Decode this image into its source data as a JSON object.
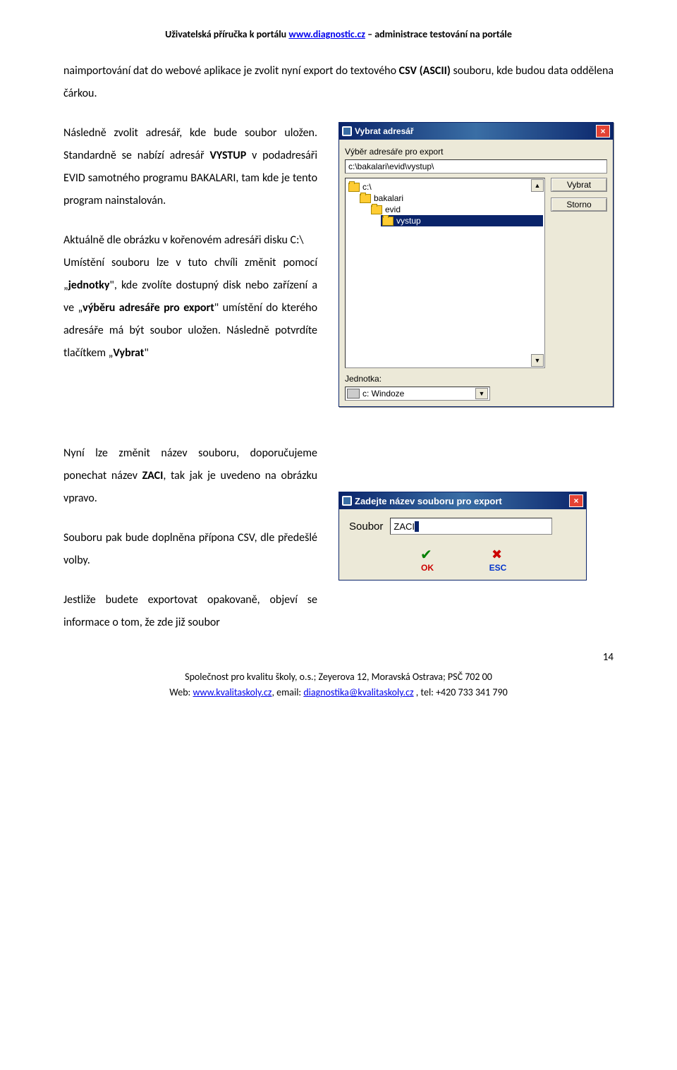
{
  "header": {
    "prefix": "Uživatelská příručka k portálu ",
    "link": "www.diagnostic.cz",
    "suffix": " – administrace testování na portále"
  },
  "p1": {
    "t1": "naimportování dat do webové aplikace je zvolit nyní export do textového ",
    "bold1": "CSV (ASCII)",
    "t2": " souboru, kde budou data oddělena čárkou."
  },
  "p2": {
    "t1": "Následně zvolit adresář, kde bude soubor uložen. Standardně se nabízí adresář ",
    "bold1": "VYSTUP",
    "t2": " v podadresáři EVID samotného programu BAKALARI, tam kde je tento program nainstalován."
  },
  "p3": {
    "t1": "Aktuálně dle obrázku v kořenovém adresáři disku C:\\",
    "t2": "Umístění souboru lze v tuto chvíli změnit pomocí „",
    "bold1": "jednotky",
    "t3": "\", kde zvolíte dostupný disk nebo zařízení a ve „",
    "bold2": "výběru adresáře pro export",
    "t4": "\" umístění do kterého adresáře má být soubor uložen. Následně potvrdíte tlačítkem „",
    "bold3": "Vybrat",
    "t5": "\""
  },
  "p4": {
    "t1": "Nyní lze změnit název souboru, doporučujeme ponechat název ",
    "bold1": "ZACI",
    "t2": ", tak jak je uvedeno na obrázku vpravo."
  },
  "p5": "Souboru pak bude doplněna přípona CSV, dle předešlé volby.",
  "p6": "Jestliže budete exportovat opakovaně, objeví se informace o tom, že zde již soubor",
  "dialog1": {
    "title": "Vybrat adresář",
    "label_top": "Výběr adresáře pro export",
    "path": "c:\\bakalari\\evid\\vystup\\",
    "tree": {
      "root": "c:\\",
      "l1": "bakalari",
      "l2": "evid",
      "l3": "vystup"
    },
    "btn_vybrat": "Vybrat",
    "btn_storno": "Storno",
    "jednotka_label": "Jednotka:",
    "jednotka_value": "c: Windoze"
  },
  "dialog2": {
    "title": "Zadejte název souboru pro export",
    "input_label": "Soubor",
    "input_value": "ZACI",
    "ok": "OK",
    "esc": "ESC"
  },
  "pagenum": "14",
  "footer": {
    "line1": "Společnost pro kvalitu školy, o.s.; Zeyerova 12, Moravská Ostrava; PSČ 702 00",
    "web_prefix": "Web: ",
    "web_link": "www.kvalitaskoly.cz",
    "email_prefix": ", email: ",
    "email_link": "diagnostika@kvalitaskoly.cz",
    "tel_prefix": " , tel: ",
    "tel": "+420 733 341 790"
  }
}
